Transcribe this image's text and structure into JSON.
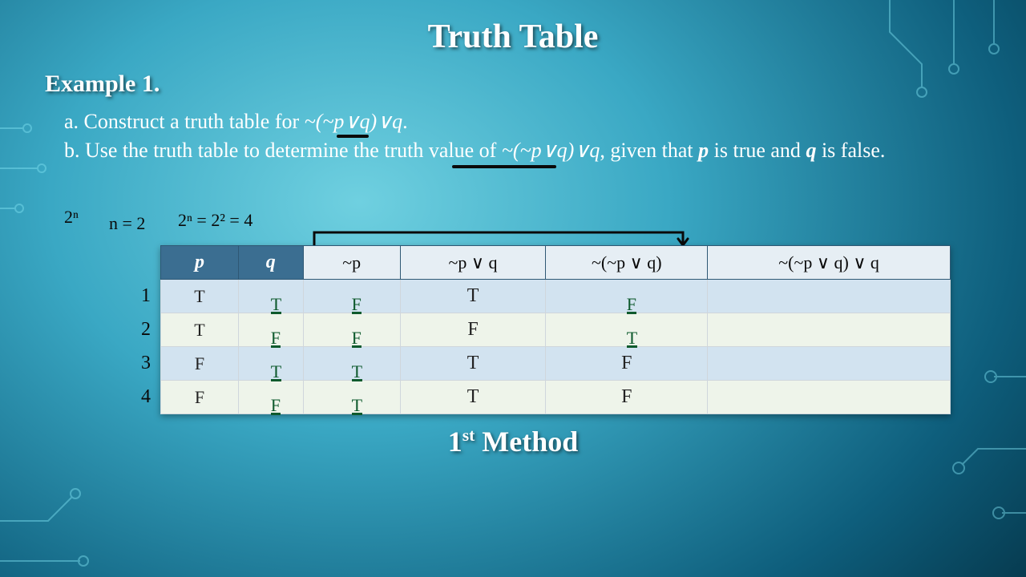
{
  "title": "Truth Table",
  "example_label": "Example 1.",
  "prompt": {
    "a_prefix": "a. Construct a truth table for ",
    "a_formula": "~(~p∨q)∨q",
    "a_suffix": ".",
    "b_prefix": "b. Use the truth table to determine the truth value of ",
    "b_formula": "~(~p∨q)∨q",
    "b_mid": ", given that ",
    "b_p": "p",
    "b_mid2": " is true and ",
    "b_q": "q",
    "b_suffix": " is false."
  },
  "hand": {
    "twoN": "2ⁿ",
    "nEq": "n = 2",
    "calc": "2ⁿ = 2² = 4"
  },
  "table": {
    "headers": {
      "p": "p",
      "q": "q"
    },
    "hand_headers": {
      "c1": "~p",
      "c2": "~p ∨ q",
      "c3": "~(~p ∨ q)",
      "c4": "~(~p ∨ q) ∨ q"
    },
    "row_nums": [
      "1",
      "2",
      "3",
      "4"
    ],
    "rows": [
      {
        "p": "T",
        "q": "T",
        "c1": "F",
        "c2": "T",
        "c3": "F",
        "c4": ""
      },
      {
        "p": "T",
        "q": "F",
        "c1": "F",
        "c2": "F",
        "c3": "T",
        "c4": ""
      },
      {
        "p": "F",
        "q": "T",
        "c1": "T",
        "c2": "T",
        "c3": "F",
        "c4": ""
      },
      {
        "p": "F",
        "q": "F",
        "c1": "T",
        "c2": "T",
        "c3": "F",
        "c4": ""
      }
    ]
  },
  "method_label_prefix": "1",
  "method_label_suffix": " Method",
  "method_label_ord": "st",
  "chart_data": {
    "type": "table",
    "title": "Truth table for ~(~p∨q)∨q — 1st Method (partial, handwritten columns)",
    "columns": [
      "p",
      "q",
      "~p",
      "~p∨q",
      "~(~p∨q)",
      "~(~p∨q)∨q"
    ],
    "rows": [
      [
        "T",
        "T",
        "F",
        "T",
        "F",
        ""
      ],
      [
        "T",
        "F",
        "F",
        "F",
        "T",
        ""
      ],
      [
        "F",
        "T",
        "T",
        "T",
        "F",
        ""
      ],
      [
        "F",
        "F",
        "T",
        "T",
        "F",
        ""
      ]
    ],
    "annotations": [
      "2^n",
      "n=2",
      "2^n = 2^2 = 4"
    ]
  }
}
